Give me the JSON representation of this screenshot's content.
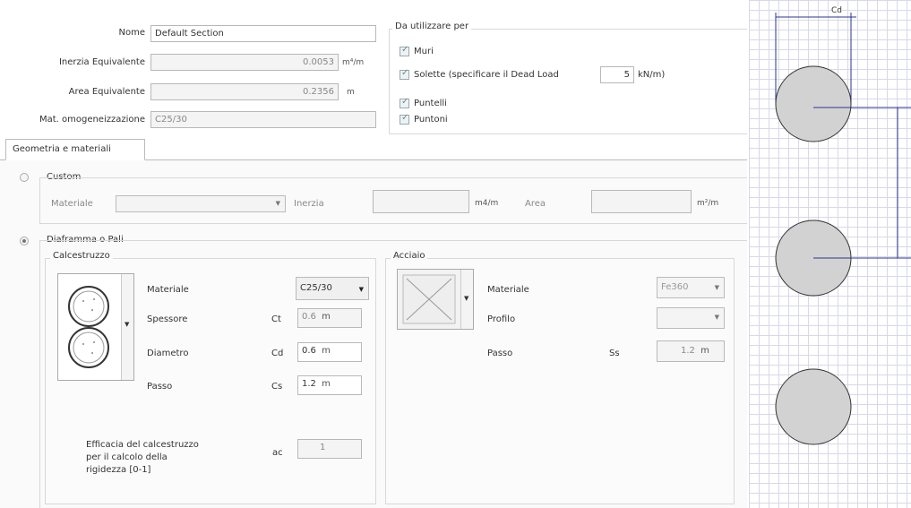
{
  "form": {
    "nome_label": "Nome",
    "nome_value": "Default Section",
    "inerzia_label": "Inerzia Equivalente",
    "inerzia_value": "0.0053",
    "inerzia_unit": "m⁴/m",
    "area_label": "Area Equivalente",
    "area_value": "0.2356",
    "area_unit": "m",
    "mat_label": "Mat. omogeneizzazione",
    "mat_value": "C25/30"
  },
  "uso": {
    "title": "Da utilizzare per",
    "muri": "Muri",
    "solette": "Solette  (specificare il Dead Load",
    "dead_load_value": "5",
    "dead_load_unit": "kN/m)",
    "puntelli": "Puntelli",
    "puntoni": "Puntoni"
  },
  "tab": {
    "label": "Geometria e materiali"
  },
  "custom": {
    "label": "Custom",
    "materiale_label": "Materiale",
    "inerzia_label": "Inerzia",
    "inerzia_unit": "m4/m",
    "area_label": "Area",
    "area_unit": "m²/m"
  },
  "diaframma": {
    "label": "Diaframma o Pali",
    "calcestruzzo": {
      "title": "Calcestruzzo",
      "materiale_label": "Materiale",
      "materiale_value": "C25/30",
      "spessore_label": "Spessore",
      "spessore_sym": "Ct",
      "spessore_value": "0.6",
      "diametro_label": "Diametro",
      "diametro_sym": "Cd",
      "diametro_value": "0.6",
      "passo_label": "Passo",
      "passo_sym": "Cs",
      "passo_value": "1.2",
      "unit": "m",
      "efficacia_line1": "Efficacia del calcestruzzo",
      "efficacia_line2": "per il calcolo della",
      "efficacia_line3": "rigidezza  [0-1]",
      "efficacia_sym": "ac",
      "efficacia_value": "1"
    },
    "acciaio": {
      "title": "Acciaio",
      "materiale_label": "Materiale",
      "materiale_value": "Fe360",
      "profilo_label": "Profilo",
      "passo_label": "Passo",
      "passo_sym": "Ss",
      "passo_value": "1.2",
      "unit": "m"
    }
  },
  "preview": {
    "cd_label": "Cd"
  }
}
